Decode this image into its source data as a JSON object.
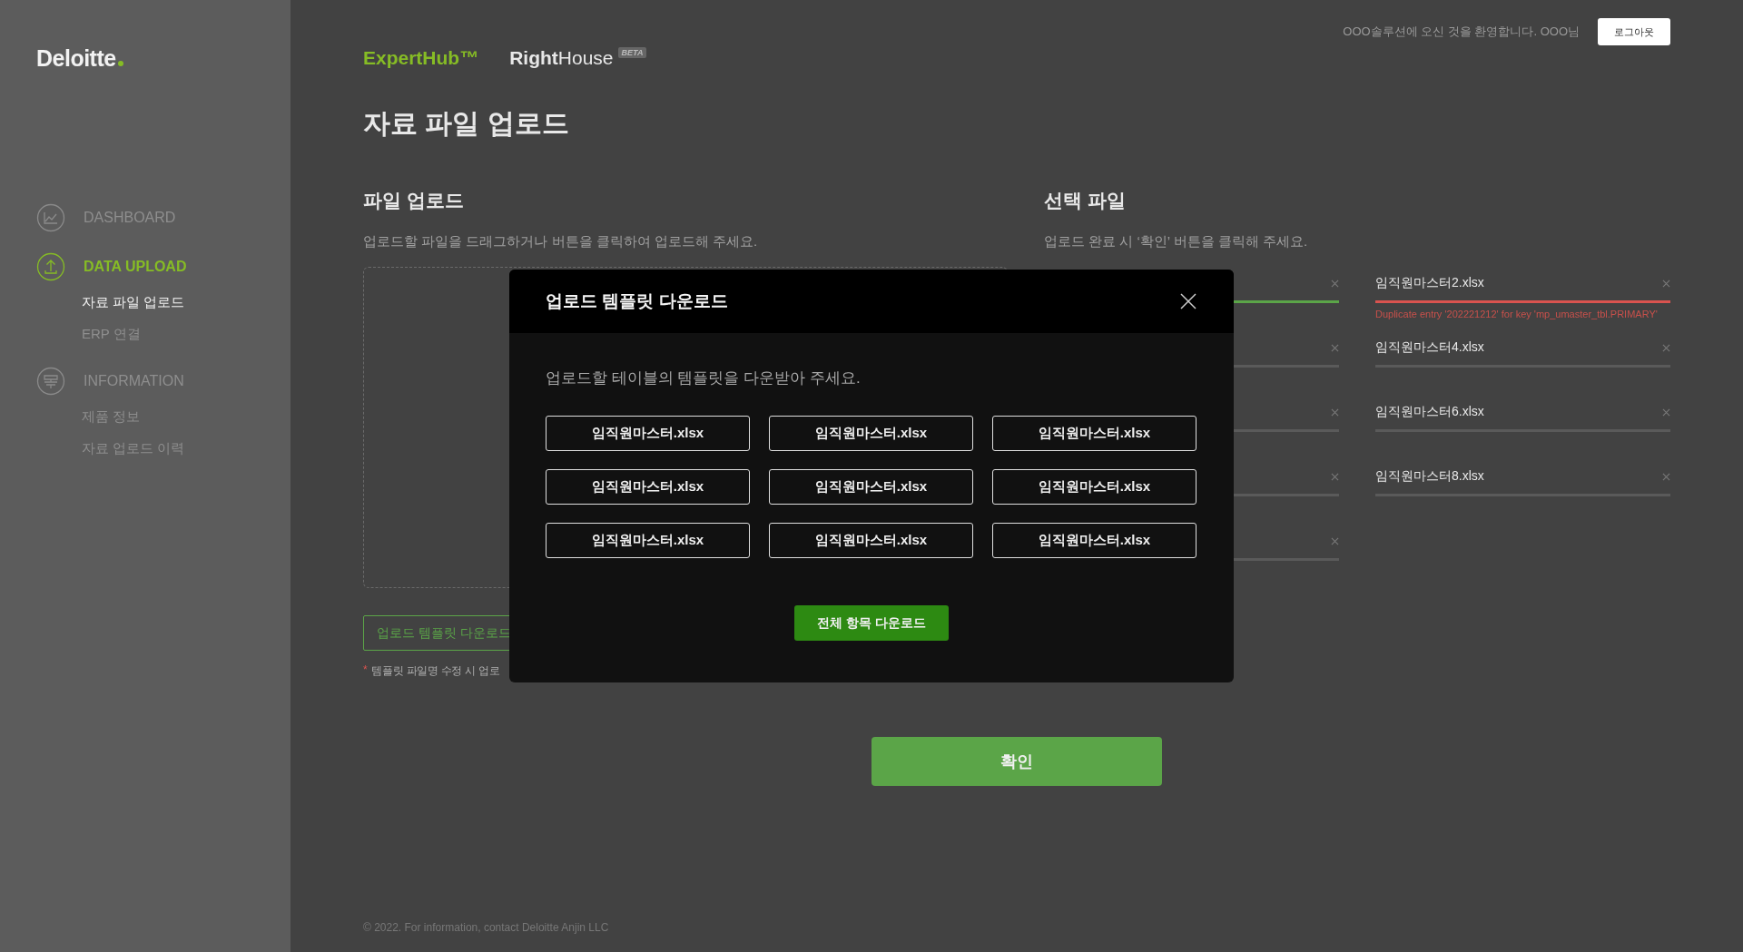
{
  "sidebar": {
    "logo": "Deloitte",
    "nav": [
      {
        "label": "DASHBOARD",
        "selected": false
      },
      {
        "label": "DATA UPLOAD",
        "selected": true,
        "children": [
          {
            "label": "자료 파일 업로드",
            "selected": true
          },
          {
            "label": "ERP 연결",
            "selected": false
          }
        ]
      },
      {
        "label": "INFORMATION",
        "selected": false,
        "children": [
          {
            "label": "제품 정보",
            "selected": false
          },
          {
            "label": "자료 업로드 이력",
            "selected": false
          }
        ]
      }
    ]
  },
  "header": {
    "brands": [
      {
        "label": "ExpertHub™",
        "selected": true
      },
      {
        "label": "**Right**House",
        "selected": false,
        "badge": "BETA"
      }
    ],
    "welcome": "OOO솔루션에 오신 것을 환영합니다. OOO님",
    "logout": "로그아웃"
  },
  "page_title": "자료 파일 업로드",
  "upload": {
    "title": "파일 업로드",
    "description": "업로드할 파일을 드래그하거나 버튼을 클릭하여 업로드해 주세요.",
    "template_button": "업로드 템플릿 다운로드",
    "note_mark": "*",
    "note": "템플릿 파일명 수정 시 업로"
  },
  "selected_files": {
    "title": "선택 파일",
    "description": "업로드 완료 시 ‘확인’ 버튼을 클릭해 주세요.",
    "columns": [
      [
        {
          "level": 1,
          "failed": false
        },
        {
          "level": 0,
          "failed": false
        },
        {
          "level": 0,
          "failed": false
        },
        {
          "level": 0,
          "failed": false
        },
        {
          "level": 0,
          "failed": false
        }
      ],
      [
        {
          "name": "임직원마스터2.xlsx",
          "level": 1,
          "failed": true,
          "error": "Duplicate entry '202221212' for key 'mp_umaster_tbl.PRIMARY'"
        },
        {
          "name": "임직원마스터4.xlsx",
          "level": 0,
          "failed": false
        },
        {
          "name": "임직원마스터6.xlsx",
          "level": 0,
          "failed": false
        },
        {
          "name": "임직원마스터8.xlsx",
          "level": 0,
          "failed": false
        }
      ]
    ]
  },
  "confirm_button": "확인",
  "footer": "© 2022. For information, contact Deloitte Anjin LLC",
  "modal": {
    "title": "업로드 템플릿 다운로드",
    "description": "업로드할 테이블의 템플릿을 다운받아 주세요.",
    "templates": [
      "임직원마스터.xlsx",
      "임직원마스터.xlsx",
      "임직원마스터.xlsx",
      "임직원마스터.xlsx",
      "임직원마스터.xlsx",
      "임직원마스터.xlsx",
      "임직원마스터.xlsx",
      "임직원마스터.xlsx",
      "임직원마스터.xlsx"
    ],
    "download_all": "전체 항목 다운로드"
  }
}
